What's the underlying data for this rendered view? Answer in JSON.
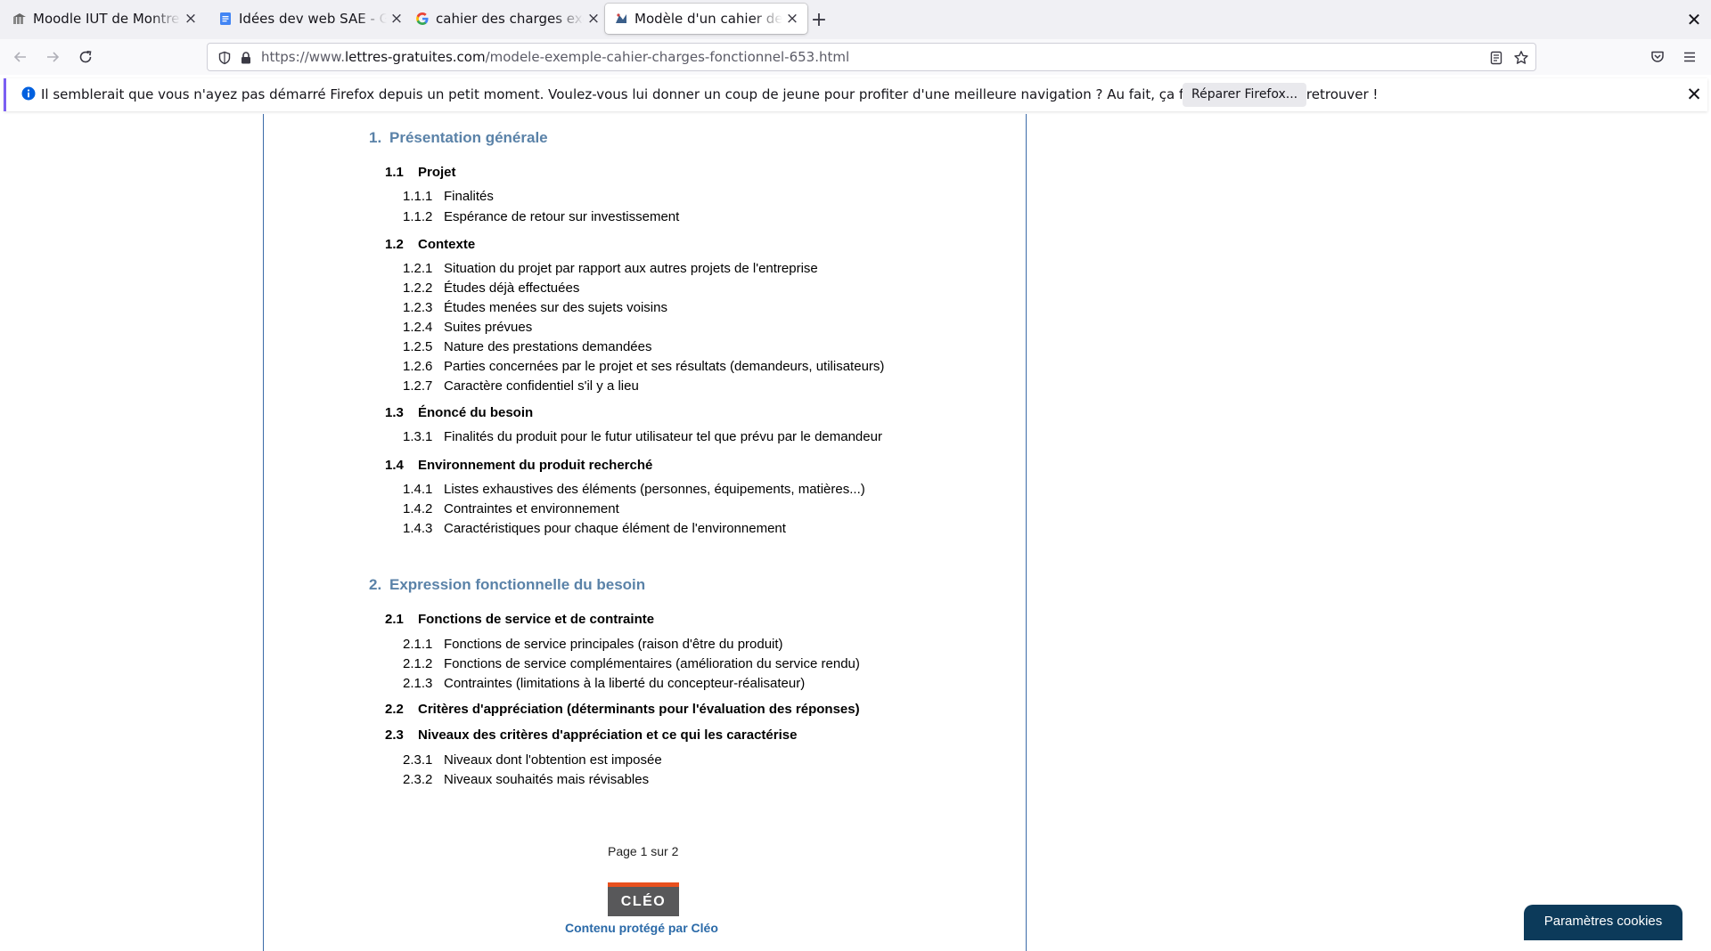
{
  "browser": {
    "tabs": [
      {
        "title": "Moodle IUT de Montreuil",
        "icon": "moodle-icon",
        "active": false
      },
      {
        "title": "Idées dev web SAE - Google Docs",
        "icon": "google-docs-icon",
        "active": false
      },
      {
        "title": "cahier des charges exemple",
        "icon": "google-icon",
        "active": false
      },
      {
        "title": "Modèle d'un cahier des charges",
        "icon": "site-favicon-icon",
        "active": true
      }
    ],
    "url": {
      "scheme_prefix": "https://www.",
      "host": "lettres-gratuites.com",
      "path": "/modele-exemple-cahier-charges-fonctionnel-653.html"
    },
    "notification": {
      "text": "Il semblerait que vous n'ayez pas démarré Firefox depuis un petit moment. Voulez-vous lui donner un coup de jeune pour profiter d'une meilleure navigation ? Au fait, ça fait plaisir de vous retrouver !",
      "button_label": "Réparer Firefox..."
    },
    "colors": {
      "accent": "#7b5ff2",
      "heading_blue": "#5a82a8",
      "frame_blue": "#3b6aa8",
      "cookie_bg": "#0c3a5a",
      "cleo_orange": "#e8501e"
    }
  },
  "document": {
    "sections": [
      {
        "number": "1.",
        "title": "Présentation générale",
        "subsections": [
          {
            "number": "1.1",
            "title": "Projet",
            "items": [
              {
                "number": "1.1.1",
                "label": "Finalités"
              },
              {
                "number": "1.1.2",
                "label": "Espérance de retour sur investissement"
              }
            ]
          },
          {
            "number": "1.2",
            "title": "Contexte",
            "items": [
              {
                "number": "1.2.1",
                "label": "Situation du projet par rapport aux autres projets de l'entreprise"
              },
              {
                "number": "1.2.2",
                "label": "Études déjà effectuées"
              },
              {
                "number": "1.2.3",
                "label": "Études menées sur des sujets voisins"
              },
              {
                "number": "1.2.4",
                "label": "Suites prévues"
              },
              {
                "number": "1.2.5",
                "label": "Nature des prestations demandées"
              },
              {
                "number": "1.2.6",
                "label": "Parties concernées par le projet et ses résultats (demandeurs, utilisateurs)"
              },
              {
                "number": "1.2.7",
                "label": "Caractère confidentiel s'il y a lieu"
              }
            ]
          },
          {
            "number": "1.3",
            "title": "Énoncé du besoin",
            "items": [
              {
                "number": "1.3.1",
                "label": "Finalités du produit pour le futur utilisateur tel que prévu par le demandeur"
              }
            ]
          },
          {
            "number": "1.4",
            "title": "Environnement du produit recherché",
            "items": [
              {
                "number": "1.4.1",
                "label": "Listes exhaustives des éléments (personnes, équipements, matières...)"
              },
              {
                "number": "1.4.2",
                "label": "Contraintes et environnement"
              },
              {
                "number": "1.4.3",
                "label": "Caractéristiques pour chaque élément de l'environnement"
              }
            ]
          }
        ]
      },
      {
        "number": "2.",
        "title": "Expression fonctionnelle du besoin",
        "subsections": [
          {
            "number": "2.1",
            "title": "Fonctions de service et de contrainte",
            "items": [
              {
                "number": "2.1.1",
                "label": "Fonctions de service principales (raison d'être du produit)"
              },
              {
                "number": "2.1.2",
                "label": "Fonctions de service complémentaires (amélioration du service rendu)"
              },
              {
                "number": "2.1.3",
                "label": "Contraintes (limitations à la liberté du concepteur-réalisateur)"
              }
            ]
          },
          {
            "number": "2.2",
            "title": "Critères d'appréciation (déterminants pour l'évaluation des réponses)",
            "items": []
          },
          {
            "number": "2.3",
            "title": "Niveaux des critères d'appréciation et ce qui les caractérise",
            "items": [
              {
                "number": "2.3.1",
                "label": "Niveaux dont l'obtention est imposée"
              },
              {
                "number": "2.3.2",
                "label": "Niveaux souhaités mais révisables"
              }
            ]
          }
        ]
      }
    ],
    "page_indicator": "Page 1 sur 2",
    "logo_text": "CLÉO",
    "protection_text": "Contenu protégé par Cléo"
  },
  "cookie_button_label": "Paramètres cookies"
}
